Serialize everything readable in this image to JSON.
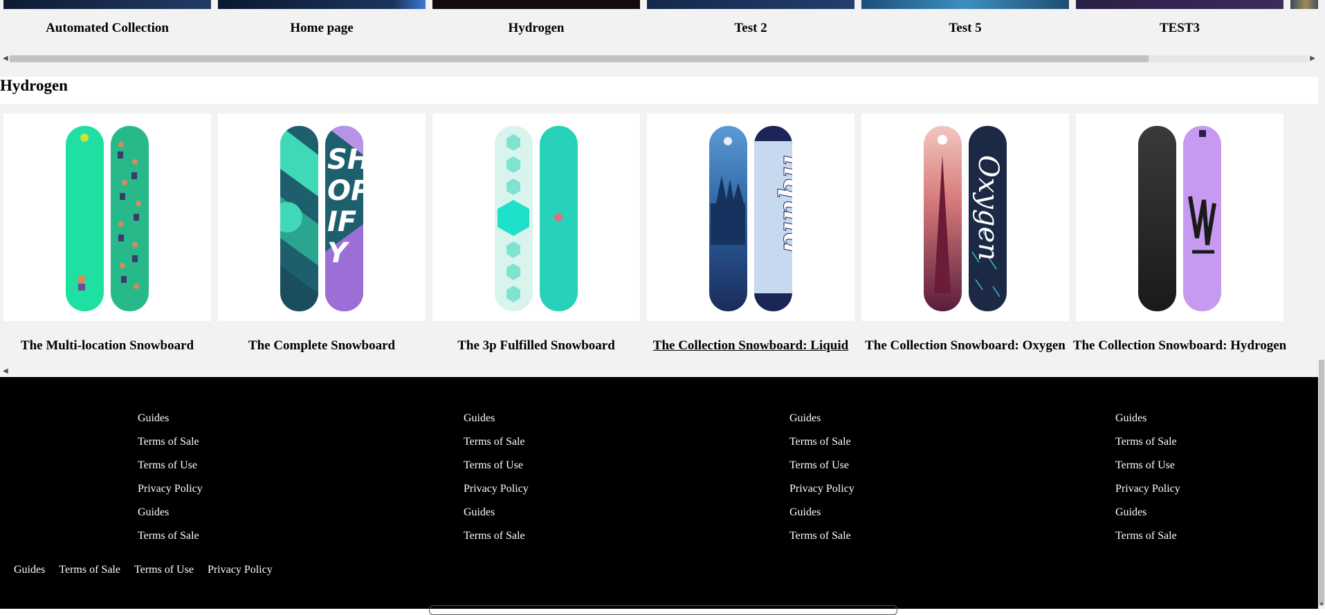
{
  "collections": {
    "items": [
      {
        "label": "Automated Collection"
      },
      {
        "label": "Home page"
      },
      {
        "label": "Hydrogen"
      },
      {
        "label": "Test 2"
      },
      {
        "label": "Test 5"
      },
      {
        "label": "TEST3"
      }
    ]
  },
  "section": {
    "title": "Hydrogen",
    "products": [
      {
        "title": "The Multi-location Snowboard"
      },
      {
        "title": "The Complete Snowboard"
      },
      {
        "title": "The 3p Fulfilled Snowboard"
      },
      {
        "title": "The Collection Snowboard: Liquid"
      },
      {
        "title": "The Collection Snowboard: Oxygen"
      },
      {
        "title": "The Collection Snowboard: Hydrogen"
      }
    ]
  },
  "footer": {
    "columns": [
      {
        "links": [
          "Guides",
          "Terms of Sale",
          "Terms of Use",
          "Privacy Policy",
          "Guides",
          "Terms of Sale"
        ]
      },
      {
        "links": [
          "Guides",
          "Terms of Sale",
          "Terms of Use",
          "Privacy Policy",
          "Guides",
          "Terms of Sale"
        ]
      },
      {
        "links": [
          "Guides",
          "Terms of Sale",
          "Terms of Use",
          "Privacy Policy",
          "Guides",
          "Terms of Sale"
        ]
      },
      {
        "links": [
          "Guides",
          "Terms of Sale",
          "Terms of Use",
          "Privacy Policy",
          "Guides",
          "Terms of Sale"
        ]
      }
    ],
    "bottom_links": [
      "Guides",
      "Terms of Sale",
      "Terms of Use",
      "Privacy Policy"
    ]
  }
}
